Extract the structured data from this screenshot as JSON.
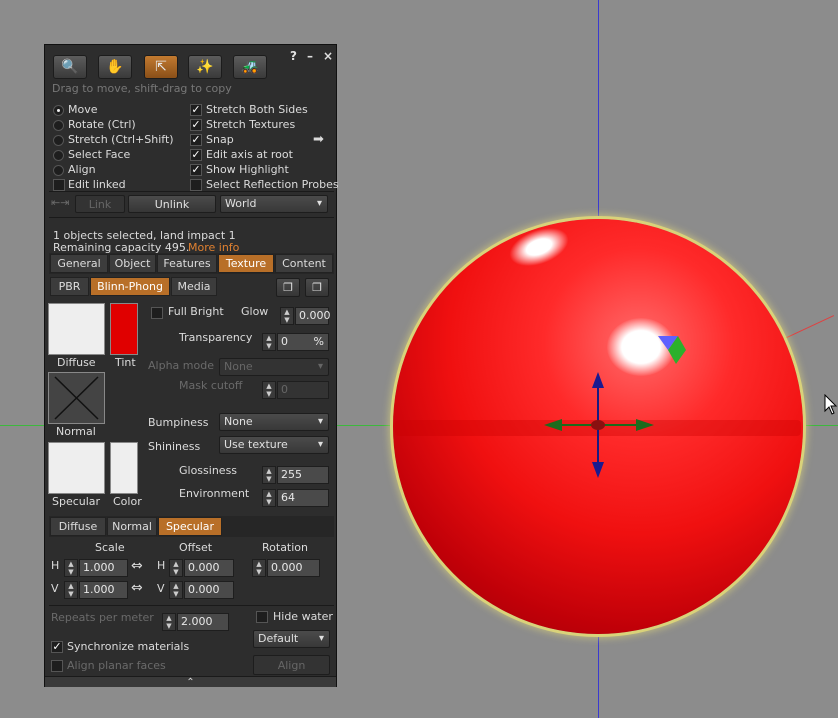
{
  "toolbar": {
    "tools": [
      {
        "name": "focus-tool",
        "icon": "🔍",
        "active": false
      },
      {
        "name": "move-tool",
        "icon": "✋",
        "active": false
      },
      {
        "name": "edit-tool",
        "icon": "⇱",
        "active": true
      },
      {
        "name": "create-tool",
        "icon": "✨",
        "active": false
      },
      {
        "name": "land-tool",
        "icon": "🚜",
        "active": false
      }
    ],
    "help": "?",
    "minimize": "–",
    "close": "×"
  },
  "hint": "Drag to move, shift-drag to copy",
  "modes": [
    {
      "label": "Move",
      "selected": true
    },
    {
      "label": "Rotate (Ctrl)",
      "selected": false
    },
    {
      "label": "Stretch (Ctrl+Shift)",
      "selected": false
    },
    {
      "label": "Select Face",
      "selected": false
    },
    {
      "label": "Align",
      "selected": false
    }
  ],
  "edit_linked": {
    "label": "Edit linked",
    "checked": false
  },
  "options": [
    {
      "label": "Stretch Both Sides",
      "checked": true
    },
    {
      "label": "Stretch Textures",
      "checked": true
    },
    {
      "label": "Snap",
      "checked": true
    },
    {
      "label": "Edit axis at root",
      "checked": true
    },
    {
      "label": "Show Highlight",
      "checked": true
    },
    {
      "label": "Select Reflection Probes",
      "checked": false
    }
  ],
  "snap_arrow": "➡",
  "link_row": {
    "link": "Link",
    "unlink": "Unlink",
    "ruler": "World"
  },
  "status": {
    "selected": "1 objects selected, land impact 1",
    "remaining": "Remaining capacity 495.",
    "more_info": "More info"
  },
  "main_tabs": [
    "General",
    "Object",
    "Features",
    "Texture",
    "Content"
  ],
  "main_tab_active": "Texture",
  "mat_tabs": [
    "PBR",
    "Blinn-Phong",
    "Media"
  ],
  "mat_tab_active": "Blinn-Phong",
  "diffuse": {
    "label": "Diffuse",
    "tint_label": "Tint",
    "tint_color": "#e00000"
  },
  "full_bright": {
    "label": "Full Bright",
    "checked": false
  },
  "glow": {
    "label": "Glow",
    "value": "0.000"
  },
  "transparency": {
    "label": "Transparency",
    "value": "0",
    "unit": "%"
  },
  "alpha_mode": {
    "label": "Alpha mode",
    "value": "None"
  },
  "mask_cutoff": {
    "label": "Mask cutoff",
    "value": "0"
  },
  "normal": {
    "label": "Normal"
  },
  "bumpiness": {
    "label": "Bumpiness",
    "value": "None"
  },
  "shininess": {
    "label": "Shininess",
    "value": "Use texture"
  },
  "specular": {
    "label": "Specular",
    "color_label": "Color"
  },
  "glossiness": {
    "label": "Glossiness",
    "value": "255"
  },
  "environment": {
    "label": "Environment",
    "value": "64"
  },
  "map_tabs": [
    "Diffuse",
    "Normal",
    "Specular"
  ],
  "map_tab_active": "Specular",
  "transform": {
    "scale_label": "Scale",
    "offset_label": "Offset",
    "rotation_label": "Rotation",
    "h": "H",
    "v": "V",
    "scale_h": "1.000",
    "scale_v": "1.000",
    "offset_h": "0.000",
    "offset_v": "0.000",
    "rotation": "0.000"
  },
  "repeats": {
    "label": "Repeats per meter",
    "value": "2.000"
  },
  "hide_water": {
    "label": "Hide water",
    "checked": false
  },
  "mapping": {
    "value": "Default"
  },
  "sync": {
    "label": "Synchronize materials",
    "checked": true
  },
  "align_planar": {
    "label": "Align planar faces",
    "checked": false
  },
  "align_button": "Align",
  "expand": "⌃"
}
